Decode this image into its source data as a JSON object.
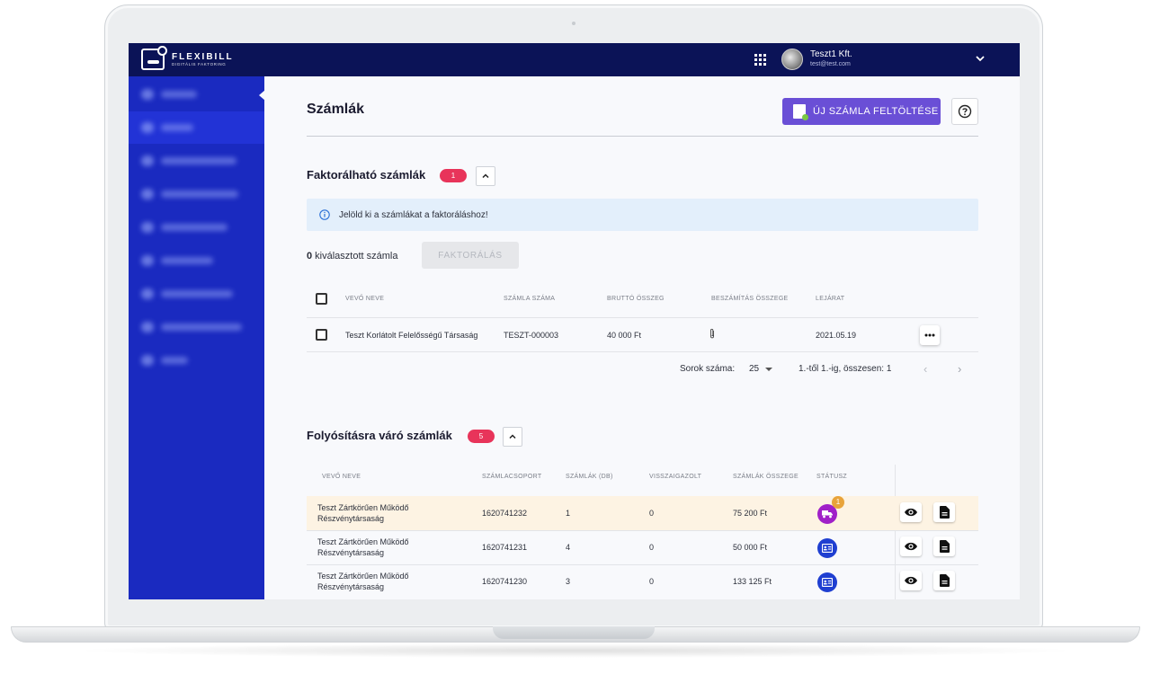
{
  "app": {
    "logo_name": "FLEXIBILL",
    "logo_sub": "DIGITÁLIS FAKTORING"
  },
  "header": {
    "user_name": "Teszt1 Kft.",
    "user_email": "test@test.com"
  },
  "page": {
    "title": "Számlák",
    "upload_label": "ÚJ SZÁMLA FELTÖLTÉSE"
  },
  "factorable": {
    "title": "Faktorálható számlák",
    "badge": "1",
    "info_text": "Jelöld ki a számlákat a faktoráláshoz!",
    "selected_count": "0",
    "selected_label": " kiválasztott számla",
    "factoring_label": "FAKTORÁLÁS",
    "columns": [
      "VEVŐ NEVE",
      "SZÁMLA SZÁMA",
      "BRUTTÓ ÖSSZEG",
      "BESZÁMÍTÁS ÖSSZEGE",
      "LEJÁRAT"
    ],
    "rows": [
      {
        "customer": "Teszt Korlátolt Felelősségű Társaság",
        "invoice_no": "TESZT-000003",
        "gross": "40 000 Ft",
        "offset": "-",
        "due": "2021.05.19"
      }
    ],
    "pager_label": "Sorok száma:",
    "pager_value": "25",
    "pager_range": "1.-től 1.-ig, összesen: 1"
  },
  "pending": {
    "title": "Folyósításra váró számlák",
    "badge": "5",
    "columns": [
      "VEVŐ NEVE",
      "SZÁMLACSOPORT",
      "SZÁMLÁK (DB)",
      "VISSZAIGAZOLT",
      "SZÁMLÁK ÖSSZEGE",
      "STÁTUSZ"
    ],
    "rows": [
      {
        "customer_line1": "Teszt Zártkörűen Működő",
        "customer_line2": "Részvénytársaság",
        "group": "1620741232",
        "count": "1",
        "confirmed": "0",
        "total": "75 200 Ft",
        "status_color": "#a020c8",
        "status_badge": "1"
      },
      {
        "customer_line1": "Teszt Zártkörűen Működő",
        "customer_line2": "Részvénytársaság",
        "group": "1620741231",
        "count": "4",
        "confirmed": "0",
        "total": "50 000 Ft",
        "status_color": "#1f3fd1"
      },
      {
        "customer_line1": "Teszt Zártkörűen Működő",
        "customer_line2": "Részvénytársaság",
        "group": "1620741230",
        "count": "3",
        "confirmed": "0",
        "total": "133 125 Ft",
        "status_color": "#1f3fd1"
      }
    ]
  },
  "colors": {
    "topbar": "#0b1357",
    "sidebar": "#1a2ac0",
    "accent": "#6a4fd6",
    "badge": "#e8345a"
  }
}
